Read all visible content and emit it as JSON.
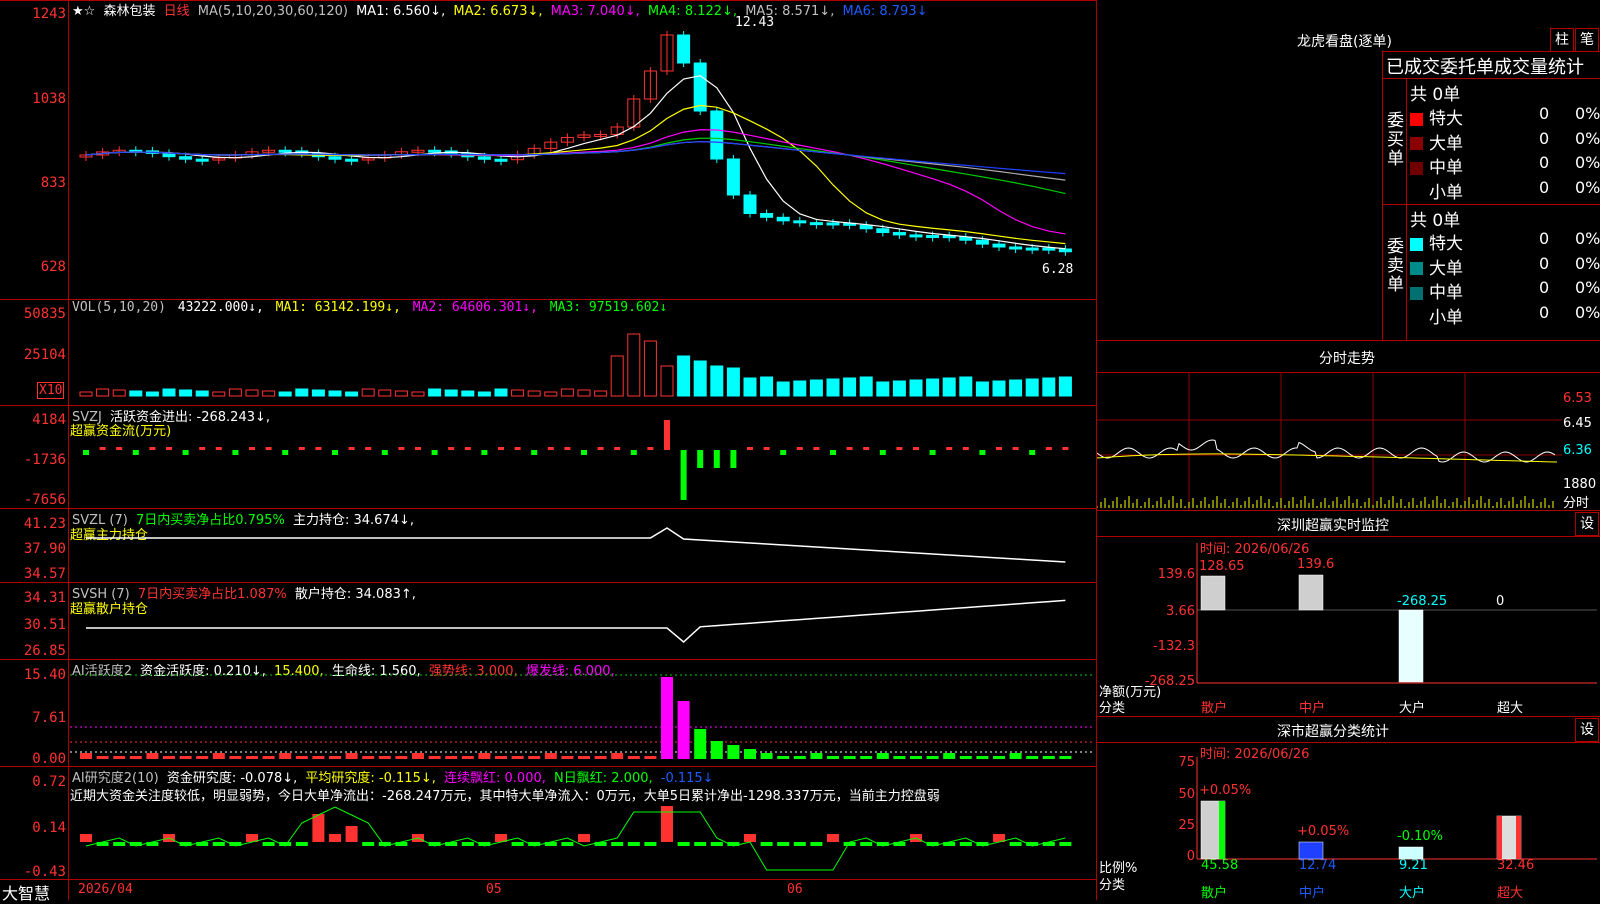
{
  "header": {
    "stars": "★☆",
    "stock_name": "森林包装",
    "period": "日线",
    "ma_label": "MA(5,10,20,30,60,120)",
    "ma1": "MA1: 6.560↓,",
    "ma2": "MA2: 6.673↓,",
    "ma3": "MA3: 7.040↓,",
    "ma4": "MA4: 8.122↓,",
    "ma5": "MA5: 8.571↓,",
    "ma6": "MA6: 8.793↓"
  },
  "price_axis": [
    "1243",
    "1038",
    "833",
    "628"
  ],
  "price_high_label": "12.43",
  "price_low_label": "6.28",
  "vol": {
    "label": "VOL(5,10,20)",
    "value": "43222.000↓,",
    "ma1": "MA1: 63142.199↓,",
    "ma2": "MA2: 64606.301↓,",
    "ma3": "MA3: 97519.602↓",
    "axis": [
      "50835",
      "25104"
    ],
    "unit": "X10"
  },
  "svzj": {
    "label": "SVZJ",
    "active": "活跃资金进出: -268.243↓,",
    "sub": "超赢资金流(万元)",
    "axis": [
      "4184",
      "-1736",
      "-7656"
    ]
  },
  "svzl": {
    "label": "SVZL (7)",
    "ratio": "7日内买卖净占比0.795%",
    "hold": "主力持仓: 34.674↓,",
    "sub": "超赢主力持仓",
    "axis": [
      "41.23",
      "37.90",
      "34.57"
    ]
  },
  "svsh": {
    "label": "SVSH (7)",
    "ratio": "7日内买卖净占比1.087%",
    "hold": "散户持仓: 34.083↑,",
    "sub": "超赢散户持仓",
    "axis": [
      "34.31",
      "30.51",
      "26.85"
    ]
  },
  "ai1": {
    "label": "AI活跃度2",
    "act": "资金活跃度: 0.210↓,",
    "v2": "15.400,",
    "life": "生命线: 1.560,",
    "strong": "强势线: 3.000,",
    "burst": "爆发线: 6.000,",
    "axis": [
      "15.40",
      "7.61",
      "0.00"
    ]
  },
  "ai2": {
    "label": "AI研究度2(10)",
    "res": "资金研究度: -0.078↓,",
    "avg": "平均研究度: -0.115↓,",
    "cont": "连续飘红: 0.000,",
    "nday": "N日飘红: 2.000,",
    "last": "-0.115↓",
    "comment": "近期大资金关注度较低，明显弱势，今日大单净流出：-268.247万元，其中特大单净流入：0万元，大单5日累计净出-1298.337万元，当前主力控盘弱",
    "axis": [
      "0.72",
      "0.14",
      "-0.43"
    ]
  },
  "bottom": {
    "brand": "大智慧",
    "date": "2026/04",
    "m5": "05",
    "m6": "06"
  },
  "right": {
    "lhb_title": "龙虎看盘(逐单)",
    "btn_zhu": "柱",
    "btn_bi": "笔",
    "stats_title": "已成交委托单成交量统计",
    "buy_side": "委买单",
    "sell_side": "委卖单",
    "buy_total": "共 0单",
    "sell_total": "共 0单",
    "rows": [
      "特大",
      "大单",
      "中单",
      "小单"
    ],
    "zero": "0",
    "pct": "0%",
    "fs_title": "分时走势",
    "fs_axis": [
      "6.53",
      "6.45",
      "6.36"
    ],
    "fs_vol": "1880",
    "fs_unit": "分时",
    "sz_title": "深圳超赢实时监控",
    "set": "设",
    "sz_time": "时间: 2026/06/26",
    "sz_axis": [
      "139.6",
      "3.66",
      "-132.3",
      "-268.25"
    ],
    "sz_vals": [
      "128.65",
      "139.6",
      "-268.25",
      "0"
    ],
    "sz_unit": "净额(万元)",
    "sz_cls": "分类",
    "cats": [
      "散户",
      "中户",
      "大户",
      "超大"
    ],
    "sc_title": "深市超赢分类统计",
    "sc_time": "时间: 2026/06/26",
    "sc_axis": [
      "75",
      "50",
      "25",
      "0"
    ],
    "sc_tops": [
      "+0.05%",
      "+0.05%",
      "-0.10%"
    ],
    "sc_vals": [
      "45.58",
      "12.74",
      "9.21",
      "32.46"
    ],
    "sc_unit": "比例%",
    "sc_cls": "分类"
  }
}
